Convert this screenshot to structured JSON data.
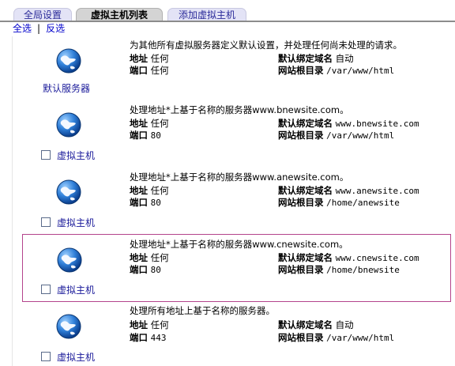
{
  "tabs": [
    {
      "label": "全局设置",
      "active": false
    },
    {
      "label": "虚拟主机列表",
      "active": true
    },
    {
      "label": "添加虚拟主机",
      "active": false
    }
  ],
  "select_all": "全选",
  "invert_select": "反选",
  "field_labels": {
    "address": "地址",
    "port": "端口",
    "server_name": "默认绑定域名",
    "doc_root": "网站根目录"
  },
  "hosts": [
    {
      "name": "默认服务器",
      "description": "为其他所有虚拟服务器定义默认设置，并处理任何尚未处理的请求。",
      "address": "任何",
      "port": "任何",
      "server_name": "自动",
      "doc_root": "/var/www/html",
      "checkbox": false,
      "selected": false
    },
    {
      "name": "虚拟主机",
      "description": "处理地址*上基于名称的服务器www.bnewsite.com。",
      "address": "任何",
      "port": "80",
      "server_name": "www.bnewsite.com",
      "doc_root": "/var/www/html",
      "checkbox": true,
      "selected": false
    },
    {
      "name": "虚拟主机",
      "description": "处理地址*上基于名称的服务器www.anewsite.com。",
      "address": "任何",
      "port": "80",
      "server_name": "www.anewsite.com",
      "doc_root": "/home/anewsite",
      "checkbox": true,
      "selected": false
    },
    {
      "name": "虚拟主机",
      "description": "处理地址*上基于名称的服务器www.cnewsite.com。",
      "address": "任何",
      "port": "80",
      "server_name": "www.cnewsite.com",
      "doc_root": "/home/bnewsite",
      "checkbox": true,
      "selected": true
    },
    {
      "name": "虚拟主机",
      "description": "处理所有地址上基于名称的服务器。",
      "address": "任何",
      "port": "443",
      "server_name": "自动",
      "doc_root": "/var/www/html",
      "checkbox": true,
      "selected": false
    }
  ]
}
